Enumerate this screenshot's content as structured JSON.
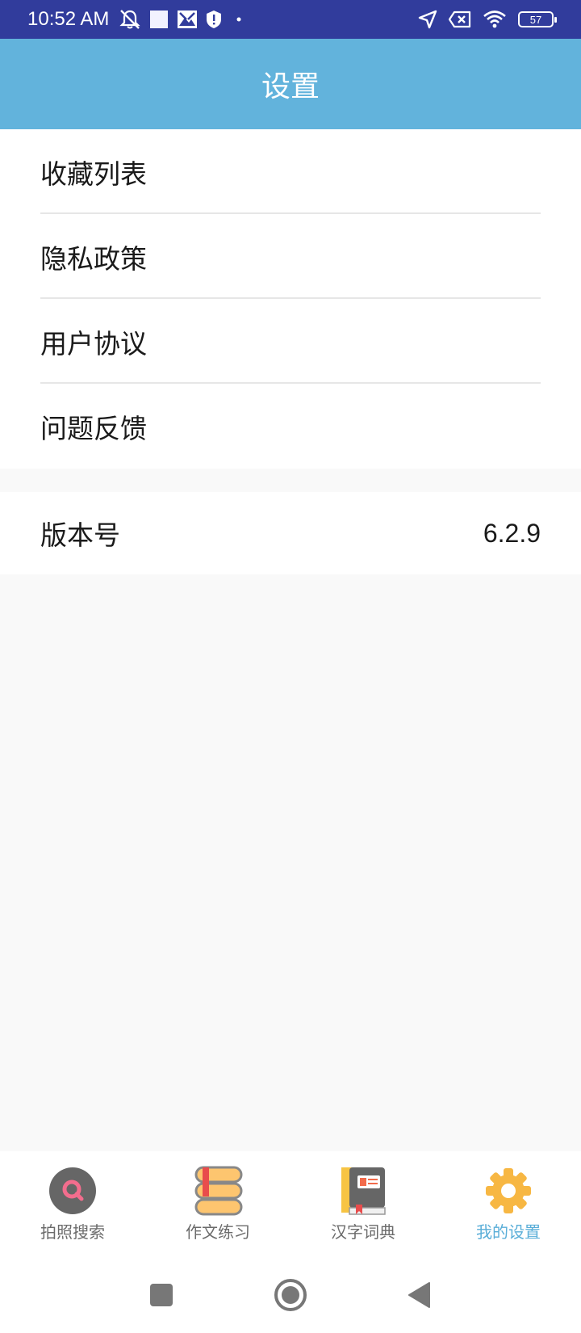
{
  "status_bar": {
    "time": "10:52 AM",
    "battery": "57",
    "left_icons": [
      "notifications-off-icon",
      "blank-square-icon",
      "photo-icon",
      "shield-icon",
      "dot-icon"
    ],
    "right_icons": [
      "location-arrow-icon",
      "sim-off-icon",
      "wifi-icon",
      "battery-icon"
    ]
  },
  "header": {
    "title": "设置"
  },
  "menu": {
    "items": [
      {
        "label": "收藏列表"
      },
      {
        "label": "隐私政策"
      },
      {
        "label": "用户协议"
      },
      {
        "label": "问题反馈"
      }
    ]
  },
  "version": {
    "label": "版本号",
    "value": "6.2.9"
  },
  "bottom_nav": {
    "items": [
      {
        "label": "拍照搜索",
        "icon": "photo-search-icon",
        "active": false
      },
      {
        "label": "作文练习",
        "icon": "books-icon",
        "active": false
      },
      {
        "label": "汉字词典",
        "icon": "dictionary-icon",
        "active": false
      },
      {
        "label": "我的设置",
        "icon": "gear-icon",
        "active": true
      }
    ],
    "active_color": "#5aaed8"
  },
  "colors": {
    "status_bar": "#313c9c",
    "title_bar": "#62b3dc",
    "background": "#f9f9f9"
  },
  "system_nav": [
    "recents-square-icon",
    "home-circle-icon",
    "back-triangle-icon"
  ]
}
